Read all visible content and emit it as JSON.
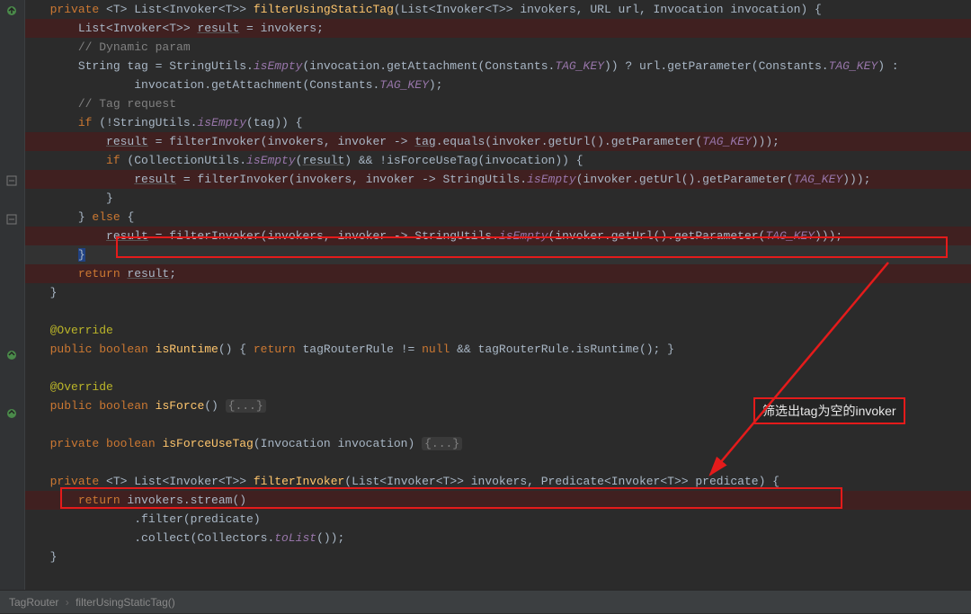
{
  "breadcrumb": {
    "file": "TagRouter",
    "method": "filterUsingStaticTag()"
  },
  "callout": "筛选出tag为空的invoker",
  "code": {
    "l1": {
      "kw1": "private ",
      "gen": "<T> ",
      "ret": "List<Invoker<T>> ",
      "name": "filterUsingStaticTag",
      "params": "(List<Invoker<T>> invokers, URL url, Invocation invocation) {"
    },
    "l2": {
      "type": "List<Invoker<T>> ",
      "var": "result",
      "rest": " = invokers;"
    },
    "l3": "// Dynamic param",
    "l4_a": "String tag = StringUtils.",
    "l4_b": "isEmpty",
    "l4_c": "(invocation.getAttachment(Constants.",
    "l4_d": "TAG_KEY",
    "l4_e": ")) ? url.getParameter(Constants.",
    "l4_f": "TAG_KEY",
    "l4_g": ") :",
    "l5_a": "invocation.getAttachment(Constants.",
    "l5_b": "TAG_KEY",
    "l5_c": ");",
    "l6": "// Tag request",
    "l7_a": "if ",
    "l7_b": "(!StringUtils.",
    "l7_c": "isEmpty",
    "l7_d": "(tag)) {",
    "l8_a": "result",
    "l8_b": " = filterInvoker(invokers, invoker -> ",
    "l8_c": "tag",
    "l8_d": ".equals(invoker.getUrl().getParameter(",
    "l8_e": "TAG_KEY",
    "l8_f": ")));",
    "l9_a": "if ",
    "l9_b": "(CollectionUtils.",
    "l9_c": "isEmpty",
    "l9_d": "(",
    "l9_e": "result",
    "l9_f": ") && !isForceUseTag(invocation)) {",
    "l10_a": "result",
    "l10_b": " = filterInvoker(invokers, invoker -> StringUtils.",
    "l10_c": "isEmpty",
    "l10_d": "(invoker.getUrl().getParameter(",
    "l10_e": "TAG_KEY",
    "l10_f": ")));",
    "l11": "}",
    "l12_a": "} ",
    "l12_b": "else ",
    "l12_c": "{",
    "l13_a": "result",
    "l13_b": " = filterInvoker(invokers, invoker -> StringUtils.",
    "l13_c": "isEmpty",
    "l13_d": "(invoker.getUrl().getParameter(",
    "l13_e": "TAG_KEY",
    "l13_f": ")));",
    "l14": "}",
    "l15_a": "return ",
    "l15_b": "result",
    "l15_c": ";",
    "l16": "}",
    "l18": "@Override",
    "l19_a": "public boolean ",
    "l19_b": "isRuntime",
    "l19_c": "() { ",
    "l19_d": "return ",
    "l19_e": "tagRouterRule != ",
    "l19_f": "null ",
    "l19_g": "&& tagRouterRule.isRuntime(); }",
    "l21": "@Override",
    "l22_a": "public boolean ",
    "l22_b": "isForce",
    "l22_c": "() ",
    "l22_d": "{...}",
    "l24_a": "private boolean ",
    "l24_b": "isForceUseTag",
    "l24_c": "(Invocation invocation) ",
    "l24_d": "{...}",
    "l26_a": "private ",
    "l26_b": "<T> ",
    "l26_c": "List<Invoker<T>> ",
    "l26_d": "filterInvoker",
    "l26_e": "(List<Invoker<T>> invokers, Predicate<Invoker<T>> predicate) {",
    "l27_a": "return ",
    "l27_b": "invokers.stream()",
    "l28": ".filter(predicate)",
    "l29_a": ".collect(Collectors.",
    "l29_b": "toList",
    "l29_c": "());",
    "l30": "}"
  }
}
